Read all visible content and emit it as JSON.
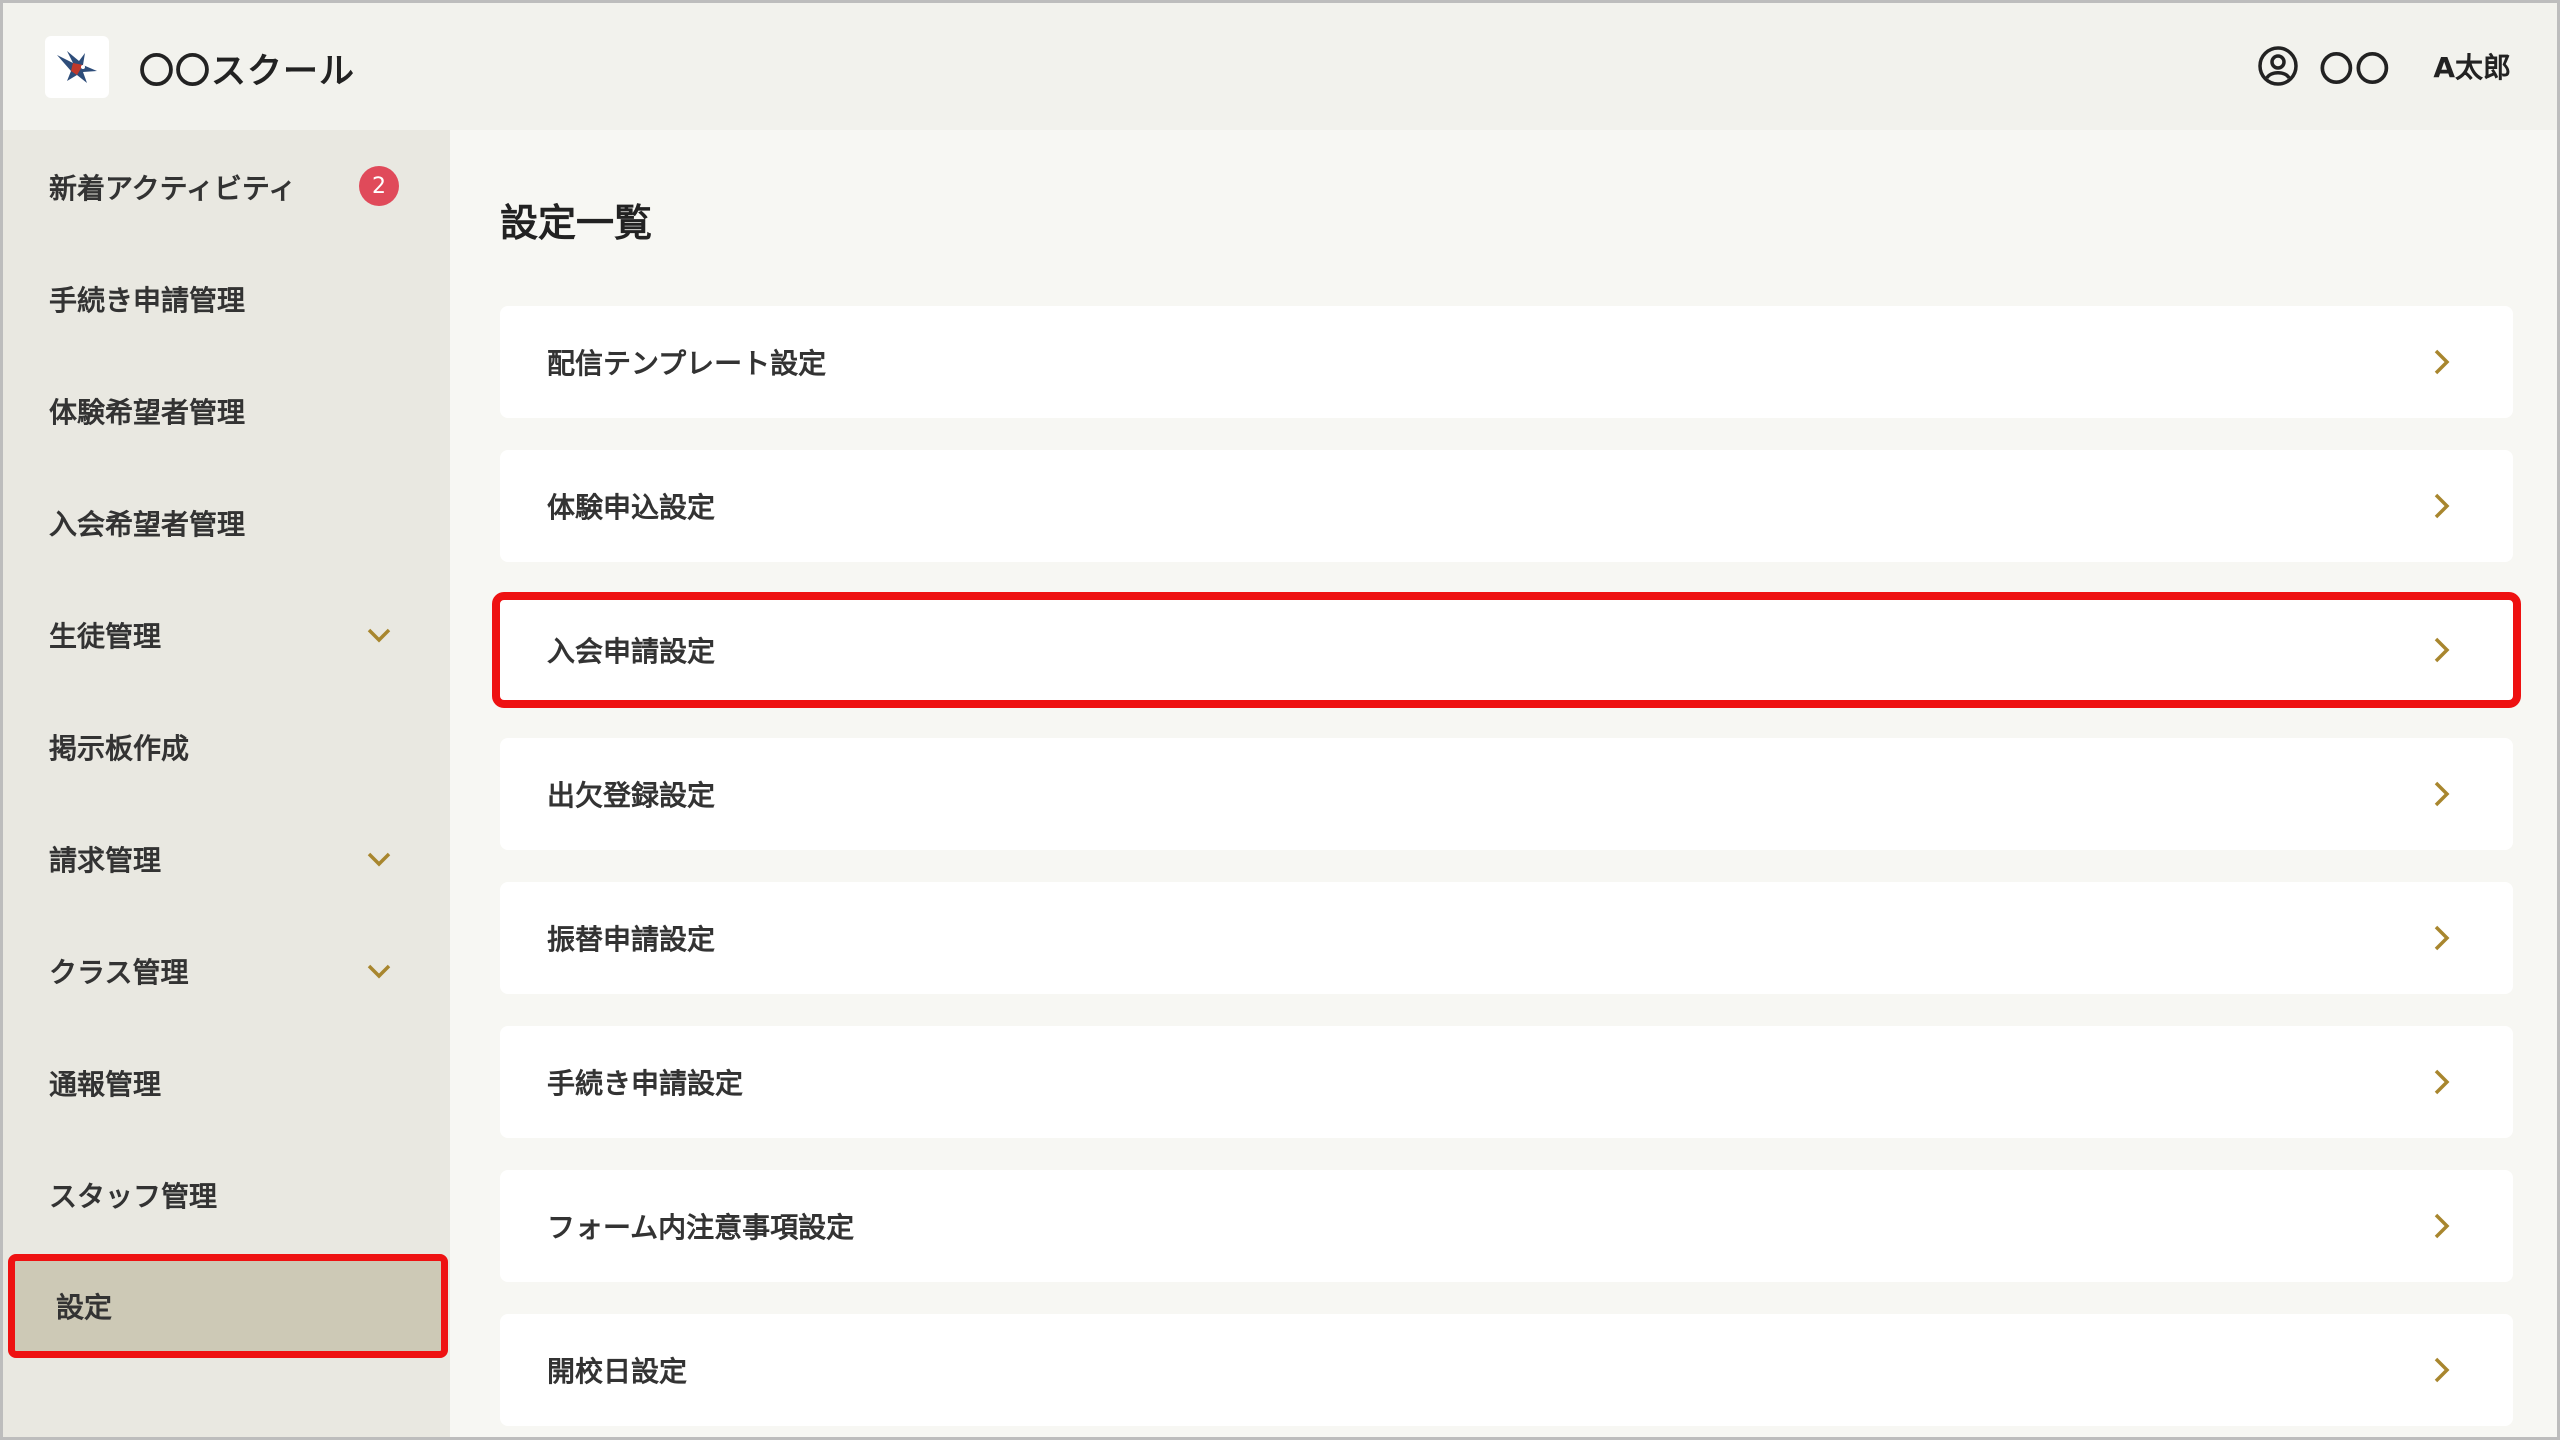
{
  "header": {
    "app_title": "〇〇スクール",
    "user_org": "〇〇",
    "user_name": "A太郎",
    "logo_icon": "bird-logo-icon",
    "user_icon": "user-circle-icon"
  },
  "sidebar": {
    "items": [
      {
        "label": "新着アクティビティ",
        "badge": "2"
      },
      {
        "label": "手続き申請管理"
      },
      {
        "label": "体験希望者管理"
      },
      {
        "label": "入会希望者管理"
      },
      {
        "label": "生徒管理",
        "expandable": true
      },
      {
        "label": "掲示板作成"
      },
      {
        "label": "請求管理",
        "expandable": true
      },
      {
        "label": "クラス管理",
        "expandable": true
      },
      {
        "label": "通報管理"
      },
      {
        "label": "スタッフ管理"
      },
      {
        "label": "設定",
        "active": true
      }
    ]
  },
  "main": {
    "title": "設定一覧",
    "settings": [
      {
        "label": "配信テンプレート設定"
      },
      {
        "label": "体験申込設定"
      },
      {
        "label": "入会申請設定",
        "highlighted": true
      },
      {
        "label": "出欠登録設定"
      },
      {
        "label": "振替申請設定"
      },
      {
        "label": "手続き申請設定"
      },
      {
        "label": "フォーム内注意事項設定"
      },
      {
        "label": "開校日設定"
      }
    ]
  },
  "colors": {
    "accent_chevron": "#a8862e",
    "highlight_border": "#ee1111",
    "badge": "#e04a5a",
    "active_nav_bg": "#cdc9b6"
  }
}
